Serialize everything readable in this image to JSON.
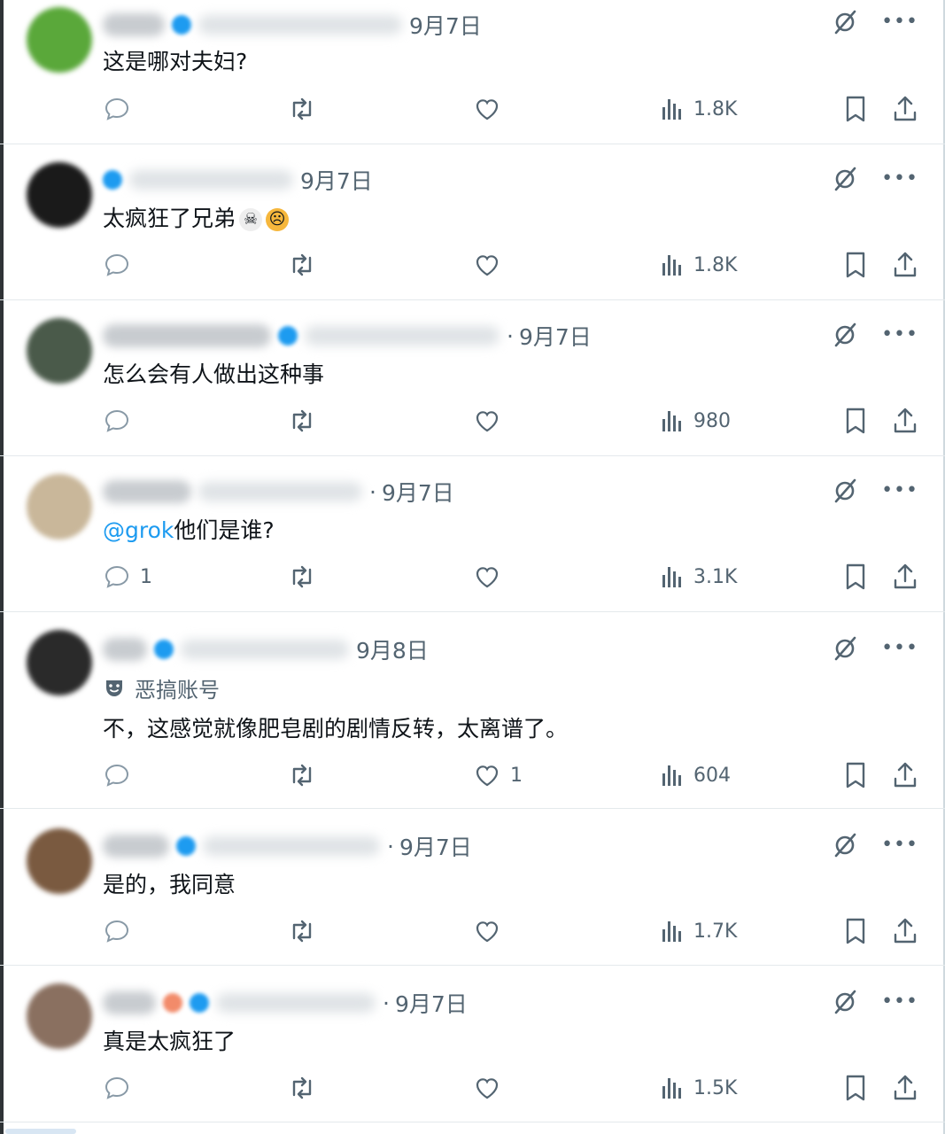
{
  "tweets": [
    {
      "date": "9月7日",
      "date_prefix": "",
      "text": "这是哪对夫妇?",
      "replies": "",
      "likes": "",
      "views": "1.8K",
      "avatar_color": "#5aa83a"
    },
    {
      "date": "9月7日",
      "date_prefix": "",
      "text": "太疯狂了兄弟",
      "emojis": [
        "skull-emoji",
        "crying-face-emoji"
      ],
      "replies": "",
      "likes": "",
      "views": "1.8K",
      "avatar_color": "#1a1a1a"
    },
    {
      "date": "9月7日",
      "date_prefix": "·",
      "text": "怎么会有人做出这种事",
      "replies": "",
      "likes": "",
      "views": "980",
      "avatar_color": "#4a5a4a"
    },
    {
      "date": "9月7日",
      "date_prefix": "·",
      "mention": "@grok",
      "text": "他们是谁?",
      "replies": "1",
      "likes": "",
      "views": "3.1K",
      "avatar_color": "#c9b79a"
    },
    {
      "date": "9月8日",
      "date_prefix": "",
      "label": "恶搞账号",
      "text": "不，这感觉就像肥皂剧的剧情反转，太离谱了。",
      "replies": "",
      "likes": "1",
      "views": "604",
      "avatar_color": "#2a2a2a"
    },
    {
      "date": "9月7日",
      "date_prefix": "·",
      "text": "是的，我同意",
      "replies": "",
      "likes": "",
      "views": "1.7K",
      "avatar_color": "#7a5a40"
    },
    {
      "date": "9月7日",
      "date_prefix": "·",
      "text": "真是太疯狂了",
      "replies": "",
      "likes": "",
      "views": "1.5K",
      "avatar_color": "#8a7060"
    }
  ],
  "colors": {
    "accent": "#1d9bf0",
    "secondary_text": "#536471",
    "divider": "#e4e9ec"
  }
}
